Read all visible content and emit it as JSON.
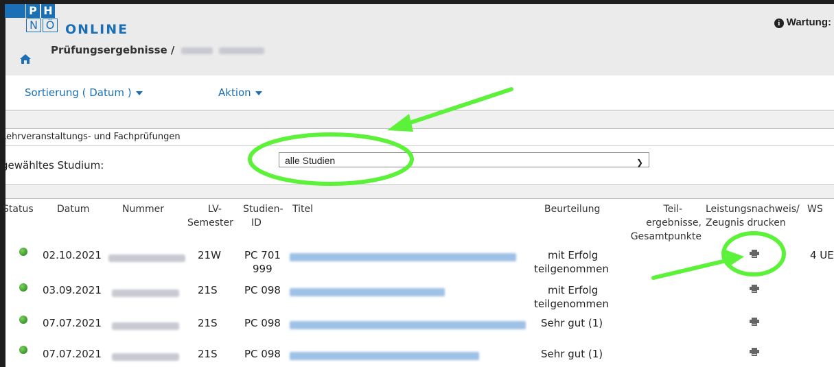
{
  "header": {
    "logo_top_letters": [
      "P",
      "H"
    ],
    "logo_bottom_letters": [
      "N",
      "Ö"
    ],
    "logo_word": "ONLINE",
    "maintenance_label": "Wartung:"
  },
  "breadcrumb": {
    "title": "Prüfungsergebnisse /",
    "icon": "home-icon"
  },
  "menubar": {
    "sort_label": "Sortierung ( Datum )",
    "action_label": "Aktion"
  },
  "section": {
    "title": "Lehrveranstaltungs- und Fachprüfungen",
    "study_label": "gewähltes Studium:",
    "study_selected": "alle Studien"
  },
  "table": {
    "columns": {
      "status": "Status",
      "datum": "Datum",
      "nummer": "Nummer",
      "lv_semester_1": "LV-",
      "lv_semester_2": "Semester",
      "studien_1": "Studien-",
      "studien_2": "ID",
      "titel": "Titel",
      "beurteilung": "Beurteilung",
      "teil_1": "Teil-",
      "teil_2": "ergebnisse,",
      "teil_3": "Gesamtpunkte",
      "leistung_1": "Leistungsnachweis/",
      "leistung_2": "Zeugnis drucken",
      "ws": "WS"
    },
    "rows": [
      {
        "datum": "02.10.2021",
        "semester": "21W",
        "studien_1": "PC 701",
        "studien_2": "999",
        "beurteilung_1": "mit Erfolg",
        "beurteilung_2": "teilgenommen",
        "ws": "4 UE"
      },
      {
        "datum": "03.09.2021",
        "semester": "21S",
        "studien_1": "PC 098",
        "studien_2": "",
        "beurteilung_1": "mit Erfolg",
        "beurteilung_2": "teilgenommen",
        "ws": ""
      },
      {
        "datum": "07.07.2021",
        "semester": "21S",
        "studien_1": "PC 098",
        "studien_2": "",
        "beurteilung_1": "Sehr gut (1)",
        "beurteilung_2": "",
        "ws": ""
      },
      {
        "datum": "07.07.2021",
        "semester": "21S",
        "studien_1": "PC 098",
        "studien_2": "",
        "beurteilung_1": "Sehr gut (1)",
        "beurteilung_2": "",
        "ws": ""
      }
    ]
  },
  "colors": {
    "brand_blue": "#1a6fb5",
    "annotation_green": "#5cf23a",
    "status_green": "#1f7a1a"
  }
}
